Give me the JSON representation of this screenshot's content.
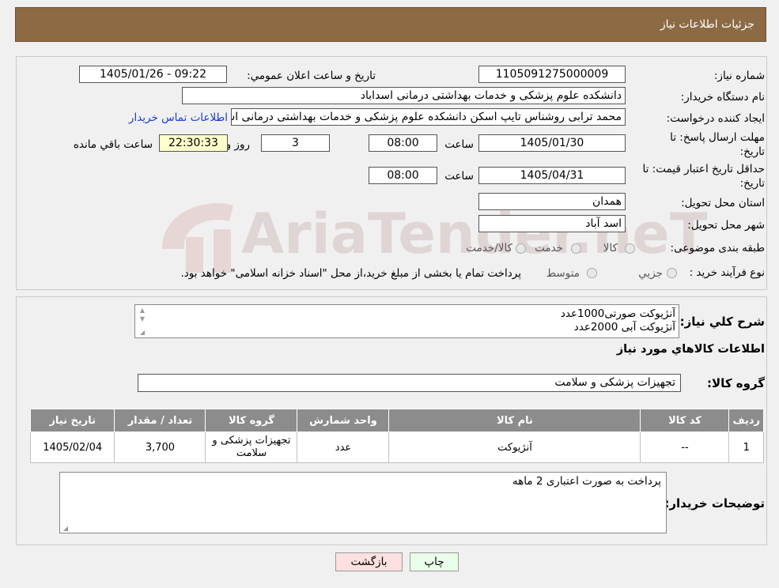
{
  "header": {
    "title": "جزئیات اطلاعات نیاز"
  },
  "form": {
    "need_number_label": "شماره نیاز:",
    "need_number": "1105091275000009",
    "announce_label": "تاریخ و ساعت اعلان عمومي:",
    "announce_value": "1405/01/26 - 09:22",
    "buyer_org_label": "نام دستگاه خريدار:",
    "buyer_org": "دانشکده علوم پزشکی و خدمات بهداشتی درمانی اسداباد",
    "requester_label": "ايجاد کننده درخواست:",
    "requester": "محمد ترابی روشناس تایپ اسکن دانشکده علوم پزشکی و خدمات بهداشتی درمانی اسداباد",
    "contact_link": "اطلاعات تماس خريدار",
    "deadline_label_1": "مهلت ارسال پاسخ: تا",
    "deadline_label_2": "تاريخ:",
    "deadline_date": "1405/01/30",
    "time_label": "ساعت",
    "deadline_time": "08:00",
    "days_count": "3",
    "days_label": "روز و",
    "remaining_time": "22:30:33",
    "remaining_label": "ساعت باقي مانده",
    "validity_label_1": "حداقل تاريخ اعتبار قيمت: تا",
    "validity_label_2": "تاريخ:",
    "validity_date": "1405/04/31",
    "validity_time": "08:00",
    "province_label": "استان محل تحويل:",
    "province": "همدان",
    "city_label": "شهر محل تحويل:",
    "city": "اسد آباد",
    "category_label": "طبقه بندی موضوعی:",
    "category_options": [
      "کالا",
      "خدمت",
      "کالا/خدمت"
    ],
    "process_label": "نوع فرآيند خريد :",
    "process_options": [
      "جزيي",
      "متوسط"
    ],
    "process_note": "پرداخت تمام يا بخشی از مبلغ خريد،از محل \"اسناد خزانه اسلامی\" خواهد بود."
  },
  "details": {
    "summary_label": "شرح کلي نياز:",
    "summary_lines": [
      "آنژیوکت صورتی1000عدد",
      "آنژیوکت آبی 2000عدد"
    ],
    "goods_info_title": "اطلاعات کالاهاي مورد نياز",
    "goods_group_label": "گروه کالا:",
    "goods_group": "تجهیزات پزشکی و سلامت",
    "table_headers": [
      "رديف",
      "کد کالا",
      "نام کالا",
      "واحد شمارش",
      "گروه کالا",
      "تعداد / مقدار",
      "تاريخ نياز"
    ],
    "rows": [
      {
        "row": "1",
        "code": "--",
        "name": "آنژیوکت",
        "unit": "عدد",
        "group": "تجهیزات پزشکی و سلامت",
        "qty": "3,700",
        "date": "1405/02/04"
      }
    ],
    "buyer_notes_label": "توضيحات خريدار:",
    "buyer_notes": "پرداخت به صورت اعتباری 2 ماهه"
  },
  "buttons": {
    "print": "چاپ",
    "back": "بازگشت"
  },
  "watermark": "AriaTender.neT",
  "colors": {
    "header_bg": "#8b6a44",
    "table_header": "#8c8c8c",
    "remaining_bg": "#ffffcc",
    "back_button": "#ffe0e0",
    "print_button": "#eaffea",
    "link": "#1a3bd6"
  }
}
